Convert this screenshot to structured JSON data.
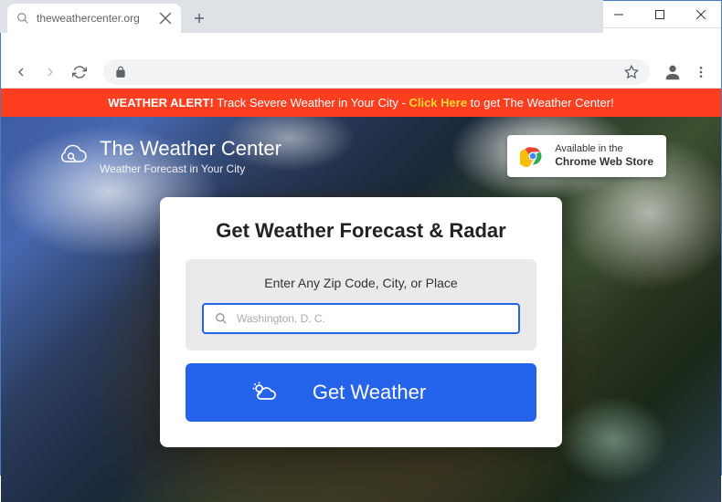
{
  "browser": {
    "tab_title": "theweathercenter.org",
    "url": ""
  },
  "alert": {
    "prefix": "WEATHER ALERT!",
    "text1": " Track Severe Weather in Your City - ",
    "link": "Click Here",
    "text2": " to get The Weather Center!"
  },
  "brand": {
    "title": "The Weather Center",
    "subtitle": "Weather Forecast in Your City"
  },
  "store_badge": {
    "line1": "Available in the",
    "line2": "Chrome Web Store"
  },
  "card": {
    "title": "Get Weather Forecast & Radar",
    "input_label": "Enter Any Zip Code, City, or Place",
    "placeholder": "Washington, D. C.",
    "button": "Get Weather"
  }
}
